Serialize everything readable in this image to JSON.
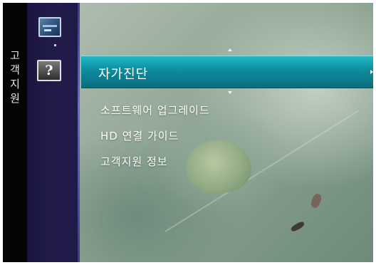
{
  "sidebar": {
    "vertical_title": [
      "고",
      "객",
      "지",
      "원"
    ],
    "icons": [
      {
        "name": "support-icon",
        "selected": false
      },
      {
        "name": "help-question-icon",
        "glyph": "?",
        "selected": true
      }
    ]
  },
  "menu": {
    "selected_item": "자가진단",
    "items": [
      "소프트웨어 업그레이드",
      "HD 연결 가이드",
      "고객지원 정보"
    ]
  },
  "colors": {
    "highlight": "#0e8fa0",
    "sidebar": "#1e1a46",
    "background": "#8fa593"
  }
}
